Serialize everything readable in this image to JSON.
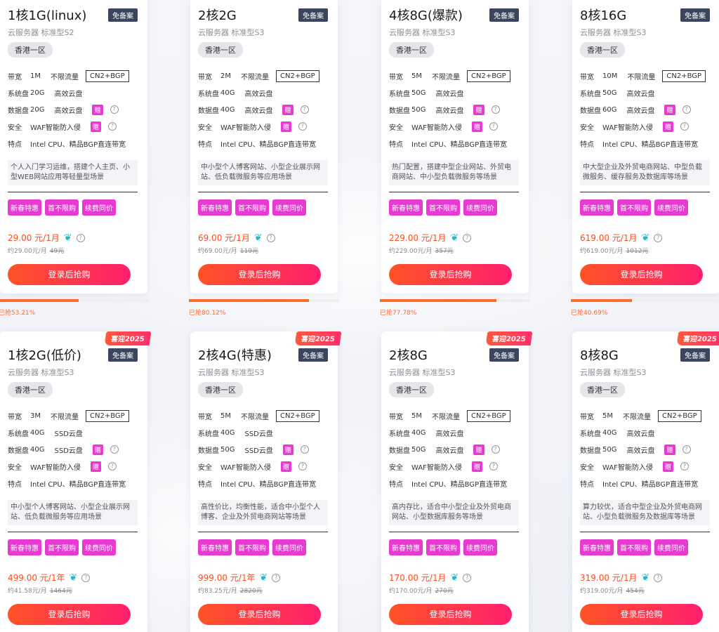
{
  "cards": [
    {
      "title": "1核1G(linux)",
      "badge": "免备案",
      "subtitle": "云服务器 标准型S2",
      "region": "香港一区",
      "bandwidth": "1M",
      "traffic": "不限流量",
      "line": "CN2+BGP",
      "sys_disk": "20G",
      "sys_disk_type": "高效云盘",
      "data_disk": "20G",
      "data_disk_type": "高效云盘",
      "gift": "赠",
      "security": "WAF智能防入侵",
      "features": "Intel CPU、精品BGP直连带宽",
      "desc": "个人入门学习运维，搭建个人主页、小型WEB网站应用等轻量型场景",
      "promos": [
        "新春特惠",
        "首不限购",
        "续费同价"
      ],
      "price": "29.00 元/1月",
      "monthly": "约29.00元/月",
      "original": "49元",
      "buy_label": "登录后抢购",
      "sold_label": "已抢53.21%",
      "sold": 0.5321,
      "ribbon": ""
    },
    {
      "title": "2核2G",
      "badge": "免备案",
      "subtitle": "云服务器 标准型S3",
      "region": "香港一区",
      "bandwidth": "2M",
      "traffic": "不限流量",
      "line": "CN2+BGP",
      "sys_disk": "40G",
      "sys_disk_type": "高效云盘",
      "data_disk": "40G",
      "data_disk_type": "高效云盘",
      "gift": "赠",
      "security": "WAF智能防入侵",
      "features": "Intel CPU、精品BGP直连带宽",
      "desc": "中小型个人博客网站、小型企业展示网站、低负载微服务等应用场景",
      "promos": [
        "新春特惠",
        "首不限购",
        "续费同价"
      ],
      "price": "69.00 元/1月",
      "monthly": "约69.00元/月",
      "original": "119元",
      "buy_label": "登录后抢购",
      "sold_label": "已抢80.12%",
      "sold": 0.8012,
      "ribbon": ""
    },
    {
      "title": "4核8G(爆款)",
      "badge": "免备案",
      "subtitle": "云服务器 标准型S3",
      "region": "香港一区",
      "bandwidth": "5M",
      "traffic": "不限流量",
      "line": "CN2+BGP",
      "sys_disk": "50G",
      "sys_disk_type": "高效云盘",
      "data_disk": "50G",
      "data_disk_type": "高效云盘",
      "gift": "赠",
      "security": "WAF智能防入侵",
      "features": "Intel CPU、精品BGP直连带宽",
      "desc": "热门配置，搭建中型企业网站、外贸电商网站、中小型负载微服务等场景",
      "promos": [
        "新春特惠",
        "首不限购",
        "续费同价"
      ],
      "price": "229.00 元/1月",
      "monthly": "约229.00元/月",
      "original": "357元",
      "buy_label": "登录后抢购",
      "sold_label": "已抢77.78%",
      "sold": 0.7778,
      "ribbon": ""
    },
    {
      "title": "8核16G",
      "badge": "免备案",
      "subtitle": "云服务器 标准型S3",
      "region": "香港一区",
      "bandwidth": "10M",
      "traffic": "不限流量",
      "line": "CN2+BGP",
      "sys_disk": "50G",
      "sys_disk_type": "高效云盘",
      "data_disk": "60G",
      "data_disk_type": "高效云盘",
      "gift": "赠",
      "security": "WAF智能防入侵",
      "features": "Intel CPU、精品BGP直连带宽",
      "desc": "中大型企业及外贸电商网站、中型负载微服务、缓存服务及数据库等场景",
      "promos": [
        "新春特惠",
        "首不限购",
        "续费同价"
      ],
      "price": "619.00 元/1月",
      "monthly": "约619.00元/月",
      "original": "1012元",
      "buy_label": "登录后抢购",
      "sold_label": "已抢40.69%",
      "sold": 0.4069,
      "ribbon": ""
    },
    {
      "title": "1核2G(低价)",
      "badge": "免备案",
      "subtitle": "云服务器 标准型S3",
      "region": "香港一区",
      "bandwidth": "3M",
      "traffic": "不限流量",
      "line": "CN2+BGP",
      "sys_disk": "40G",
      "sys_disk_type": "SSD云盘",
      "data_disk": "40G",
      "data_disk_type": "SSD云盘",
      "gift": "赠",
      "security": "WAF智能防入侵",
      "features": "Intel CPU、精品BGP直连带宽",
      "desc": "中小型个人博客网站、小型企业展示网站、低负载微服务等应用场景",
      "promos": [
        "新春特惠",
        "首不限购",
        "续费同价"
      ],
      "price": "499.00 元/1年",
      "monthly": "约41.58元/月",
      "original": "1464元",
      "buy_label": "登录后抢购",
      "ribbon": "喜迎2025"
    },
    {
      "title": "2核4G(特惠)",
      "badge": "免备案",
      "subtitle": "云服务器 标准型S3",
      "region": "香港一区",
      "bandwidth": "5M",
      "traffic": "不限流量",
      "line": "CN2+BGP",
      "sys_disk": "40G",
      "sys_disk_type": "SSD云盘",
      "data_disk": "50G",
      "data_disk_type": "SSD云盘",
      "gift": "赠",
      "security": "WAF智能防入侵",
      "features": "Intel CPU、精品BGP直连带宽",
      "desc": "高性价比，均衡性能，适合中小型个人博客、企业及外贸电商网站等场景",
      "promos": [
        "新春特惠",
        "首不限购",
        "续费同价"
      ],
      "price": "999.00 元/1年",
      "monthly": "约83.25元/月",
      "original": "2820元",
      "buy_label": "登录后抢购",
      "ribbon": "喜迎2025"
    },
    {
      "title": "2核8G",
      "badge": "免备案",
      "subtitle": "云服务器 标准型S3",
      "region": "香港一区",
      "bandwidth": "5M",
      "traffic": "不限流量",
      "line": "CN2+BGP",
      "sys_disk": "40G",
      "sys_disk_type": "高效云盘",
      "data_disk": "50G",
      "data_disk_type": "高效云盘",
      "gift": "赠",
      "security": "WAF智能防入侵",
      "features": "Intel CPU、精品BGP直连带宽",
      "desc": "高内存比，适合中小型企业及外贸电商网站、小型数据库服务等场景",
      "promos": [
        "新春特惠",
        "首不限购",
        "续费同价"
      ],
      "price": "170.00 元/1月",
      "monthly": "约170.00元/月",
      "original": "270元",
      "buy_label": "登录后抢购",
      "ribbon": "喜迎2025"
    },
    {
      "title": "8核8G",
      "badge": "免备案",
      "subtitle": "云服务器 标准型S3",
      "region": "香港一区",
      "bandwidth": "5M",
      "traffic": "不限流量",
      "line": "CN2+BGP",
      "sys_disk": "40G",
      "sys_disk_type": "高效云盘",
      "data_disk": "50G",
      "data_disk_type": "高效云盘",
      "gift": "赠",
      "security": "WAF智能防入侵",
      "features": "Intel CPU、精品BGP直连带宽",
      "desc": "算力较优，适合中型企业及外贸电商网站、小型负载微服务及数据库等场景",
      "promos": [
        "新春特惠",
        "首不限购",
        "续费同价"
      ],
      "price": "319.00 元/1月",
      "monthly": "约319.00元/月",
      "original": "454元",
      "buy_label": "登录后抢购",
      "ribbon": "喜迎2025"
    }
  ],
  "labels": {
    "bandwidth": "带宽",
    "sys_disk": "系统盘",
    "data_disk": "数据盘",
    "security": "安全",
    "features": "特点"
  },
  "colors": {
    "accent": "#ff4a1a",
    "promo": "#e83ad2",
    "badge": "#3a4660"
  }
}
